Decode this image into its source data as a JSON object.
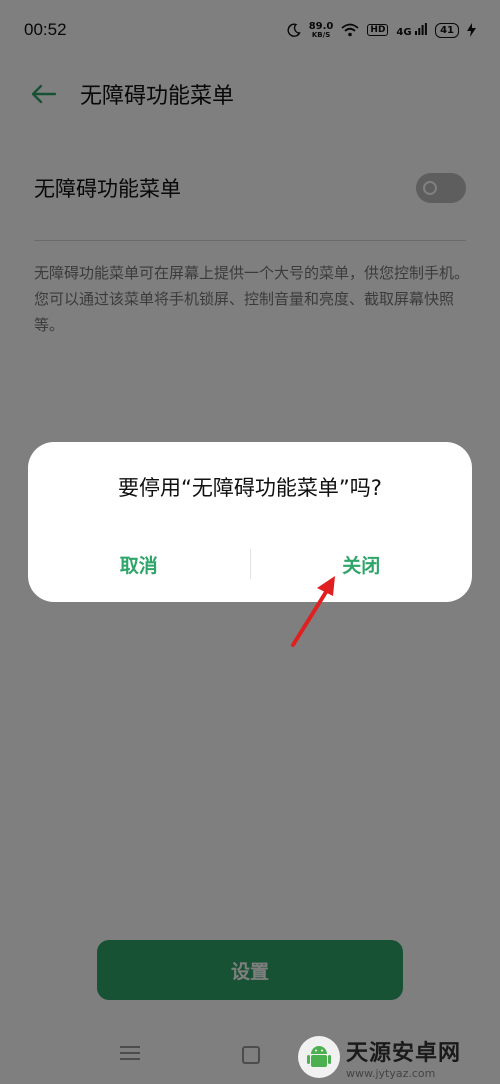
{
  "status_bar": {
    "time": "00:52",
    "net_speed_value": "89.0",
    "net_speed_unit": "KB/S",
    "hd": "HD",
    "signal": "4G",
    "battery": "41"
  },
  "header": {
    "title": "无障碍功能菜单"
  },
  "setting": {
    "label": "无障碍功能菜单",
    "toggle_on": false
  },
  "description": "无障碍功能菜单可在屏幕上提供一个大号的菜单，供您控制手机。您可以通过该菜单将手机锁屏、控制音量和亮度、截取屏幕快照等。",
  "dialog": {
    "title": "要停用“无障碍功能菜单”吗?",
    "cancel_label": "取消",
    "confirm_label": "关闭"
  },
  "settings_button_label": "设置",
  "watermark": {
    "cn": "天源安卓网",
    "en": "www.jytyaz.com"
  },
  "colors": {
    "accent": "#2fa56a",
    "arrow": "#e02020"
  }
}
